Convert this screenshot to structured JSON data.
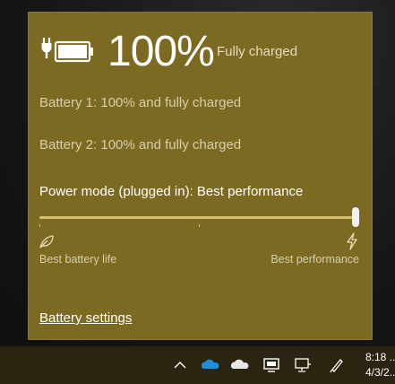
{
  "battery": {
    "percentage": "100%",
    "status": "Fully charged",
    "battery1": "Battery 1: 100% and fully charged",
    "battery2": "Battery 2: 100% and fully charged"
  },
  "power_mode": {
    "label": "Power mode (plugged in): Best performance",
    "slider_level": 1.0,
    "min_label": "Best battery life",
    "max_label": "Best performance"
  },
  "battery_settings_link": "Battery settings",
  "taskbar": {
    "tray_icons": [
      "chevron-up-icon",
      "onedrive-blue-icon",
      "onedrive-white-icon",
      "display-icon",
      "network-icon",
      "pen-icon"
    ],
    "time": "8:18 ...",
    "date": "4/3/2..."
  },
  "colors": {
    "flyout_bg": "#7d6a22",
    "accent": "#d8c070",
    "taskbar_bg": "#2a2410"
  }
}
